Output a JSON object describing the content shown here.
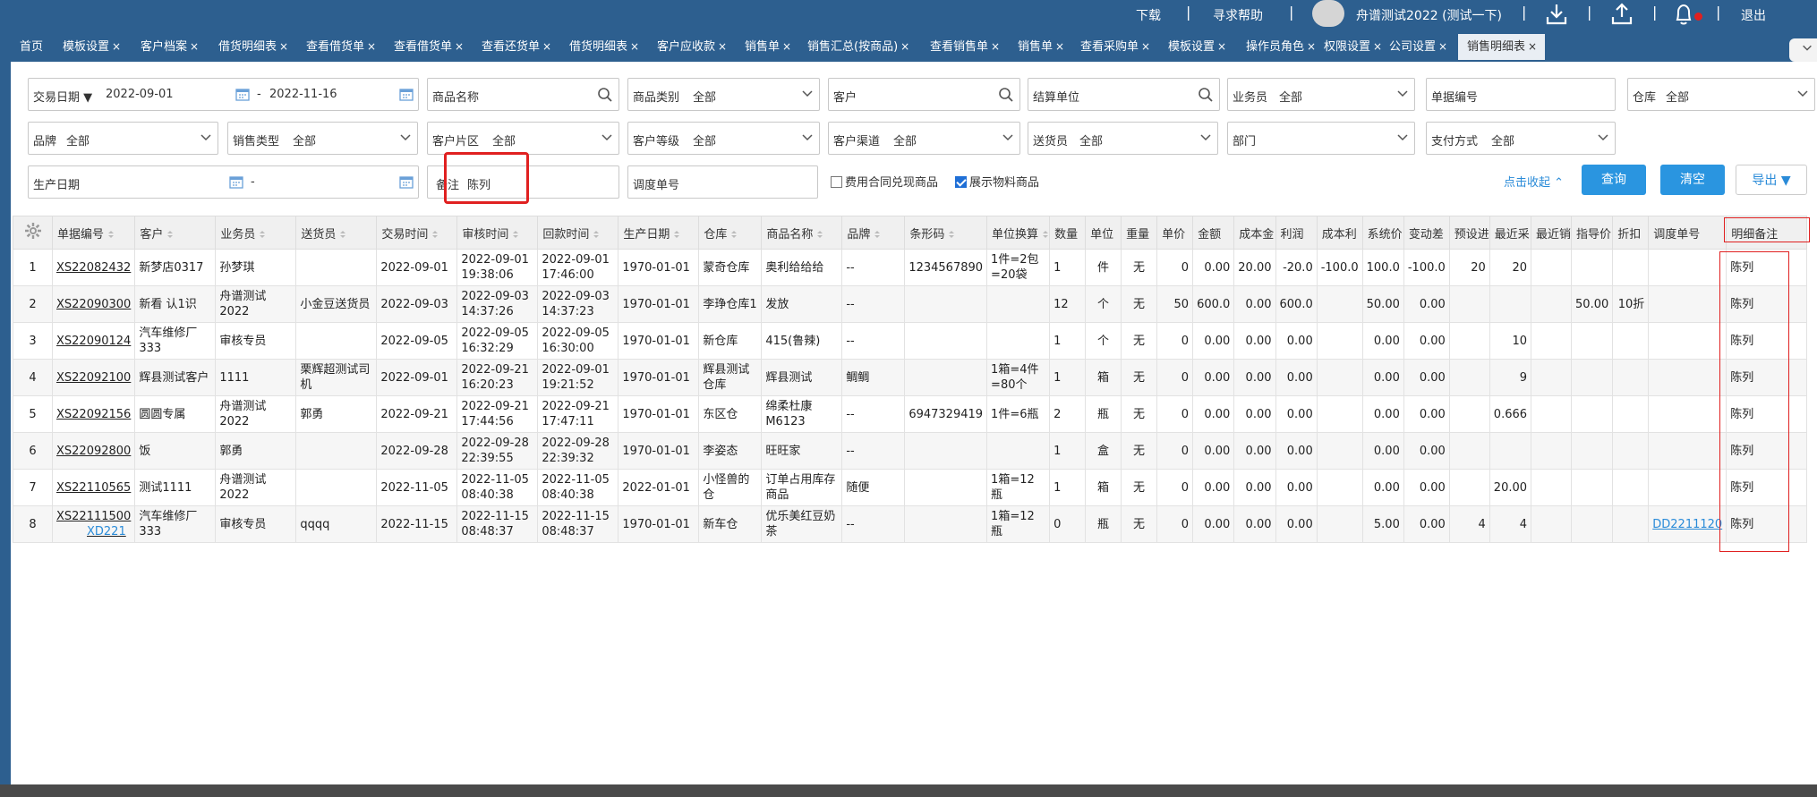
{
  "header": {
    "download": "下载",
    "help": "寻求帮助",
    "user": "舟谱测试2022 (测试一下)",
    "logout": "退出",
    "sep": "|"
  },
  "tabs": [
    {
      "label": "首页",
      "closable": false
    },
    {
      "label": "模板设置",
      "closable": true
    },
    {
      "label": "客户档案",
      "closable": true
    },
    {
      "label": "借货明细表",
      "closable": true
    },
    {
      "label": "查看借货单",
      "closable": true
    },
    {
      "label": "查看借货单",
      "closable": true
    },
    {
      "label": "查看还货单",
      "closable": true
    },
    {
      "label": "借货明细表",
      "closable": true
    },
    {
      "label": "客户应收款",
      "closable": true
    },
    {
      "label": "销售单",
      "closable": true
    },
    {
      "label": "销售汇总(按商品)",
      "closable": true
    },
    {
      "label": "查看销售单",
      "closable": true
    },
    {
      "label": "销售单",
      "closable": true
    },
    {
      "label": "查看采购单",
      "closable": true
    },
    {
      "label": "模板设置",
      "closable": true
    },
    {
      "label": "操作员角色",
      "closable": true
    },
    {
      "label": "权限设置",
      "closable": true
    },
    {
      "label": "公司设置",
      "closable": true
    },
    {
      "label": "销售明细表",
      "closable": true,
      "active": true
    }
  ],
  "tab_close": "×",
  "filters": {
    "trade_date_label": "交易日期 ▼",
    "date_from": "2022-09-01",
    "date_sep": "-",
    "date_to": "2022-11-16",
    "product_name_placeholder": "商品名称",
    "product_category_label": "商品类别",
    "customer_placeholder": "客户",
    "settle_unit_placeholder": "结算单位",
    "salesman_label": "业务员",
    "doc_no_placeholder": "单据编号",
    "warehouse_label": "仓库",
    "brand_label": "品牌",
    "sales_type_label": "销售类型",
    "customer_area_label": "客户片区",
    "customer_level_label": "客户等级",
    "customer_channel_label": "客户渠道",
    "deliverer_label": "送货员",
    "department_placeholder": "部门",
    "payment_label": "支付方式",
    "production_date_label": "生产日期",
    "production_sep": "-",
    "remark_label": "备注",
    "remark_value": "陈列",
    "dispatch_placeholder": "调度单号",
    "all": "全部"
  },
  "checks": {
    "fee_contract": "费用合同兑现商品",
    "fee_contract_checked": false,
    "show_material": "展示物料商品",
    "show_material_checked": true
  },
  "actions": {
    "collapse": "点击收起 ⌃",
    "query": "查询",
    "clear": "清空",
    "export": "导出 ▼"
  },
  "table": {
    "columns": [
      "单据编号",
      "客户",
      "业务员",
      "送货员",
      "交易时间",
      "审核时间",
      "回款时间",
      "生产日期",
      "仓库",
      "商品名称",
      "品牌",
      "条形码",
      "单位换算",
      "数量",
      "单位",
      "重量",
      "单价",
      "金额",
      "成本金",
      "利润",
      "成本利",
      "系统价",
      "变动差",
      "预设进",
      "最近采",
      "最近销",
      "指导价",
      "折扣",
      "调度单号",
      "明细备注"
    ],
    "rows": [
      [
        "1",
        "XS22082432",
        "",
        "新梦店0317",
        "孙梦琪",
        "",
        "2022-09-01",
        "2022-09-01 19:38:06",
        "2022-09-01 17:46:00",
        "1970-01-01",
        "蒙奇仓库",
        "奥利给给给",
        "--",
        "1234567890",
        "1件=2包=20袋",
        "1",
        "件",
        "无",
        "0",
        "0.00",
        "20.00",
        "-20.0",
        "-100.0",
        "100.0",
        "-100.0",
        "20",
        "20",
        "",
        "",
        "",
        "",
        "陈列"
      ],
      [
        "2",
        "XS22090300",
        "",
        "新看 认1识",
        "舟谱测试2022",
        "小金豆送货员",
        "2022-09-03",
        "2022-09-03 14:37:26",
        "2022-09-03 14:37:23",
        "1970-01-01",
        "李琤仓库1",
        "发放",
        "--",
        "",
        "",
        "12",
        "个",
        "无",
        "50",
        "600.0",
        "0.00",
        "600.0",
        "",
        "50.00",
        "0.00",
        "",
        "",
        "",
        "50.00",
        "10折",
        "",
        "陈列"
      ],
      [
        "3",
        "XS22090124",
        "",
        "汽车维修厂333",
        "审核专员",
        "",
        "2022-09-05",
        "2022-09-05 16:32:29",
        "2022-09-05 16:30:00",
        "1970-01-01",
        "新仓库",
        "415(鲁辣)",
        "--",
        "",
        "",
        "1",
        "个",
        "无",
        "0",
        "0.00",
        "0.00",
        "0.00",
        "",
        "0.00",
        "0.00",
        "",
        "10",
        "",
        "",
        "",
        "",
        "陈列"
      ],
      [
        "4",
        "XS22092100",
        "",
        "辉县测试客户",
        "1111",
        "栗辉超测试司机",
        "2022-09-01",
        "2022-09-21 16:20:23",
        "2022-09-01 19:21:52",
        "1970-01-01",
        "辉县测试仓库",
        "辉县测试",
        "鲷鲷",
        "",
        "1箱=4件=80个",
        "1",
        "箱",
        "无",
        "0",
        "0.00",
        "0.00",
        "0.00",
        "",
        "0.00",
        "0.00",
        "",
        "9",
        "",
        "",
        "",
        "",
        "陈列"
      ],
      [
        "5",
        "XS22092156",
        "",
        "圆圆专属",
        "舟谱测试2022",
        "郭勇",
        "2022-09-21",
        "2022-09-21 17:44:56",
        "2022-09-21 17:47:11",
        "1970-01-01",
        "东区仓",
        "绵柔杜康M6123",
        "--",
        "6947329419",
        "1件=6瓶",
        "2",
        "瓶",
        "无",
        "0",
        "0.00",
        "0.00",
        "0.00",
        "",
        "0.00",
        "0.00",
        "",
        "0.666",
        "",
        "",
        "",
        "",
        "陈列"
      ],
      [
        "6",
        "XS22092800",
        "",
        "饭",
        "郭勇",
        "",
        "2022-09-28",
        "2022-09-28 22:39:55",
        "2022-09-28 22:39:32",
        "1970-01-01",
        "李姿态",
        "旺旺家",
        "--",
        "",
        "",
        "1",
        "盒",
        "无",
        "0",
        "0.00",
        "0.00",
        "0.00",
        "",
        "0.00",
        "0.00",
        "",
        "",
        "",
        "",
        "",
        "",
        "陈列"
      ],
      [
        "7",
        "XS22110565",
        "",
        "测试1111",
        "舟谱测试2022",
        "",
        "2022-11-05",
        "2022-11-05 08:40:38",
        "2022-11-05 08:40:38",
        "2022-01-01",
        "小怪兽的仓",
        "订单占用库存商品",
        "随便",
        "",
        "1箱=12瓶",
        "1",
        "箱",
        "无",
        "0",
        "0.00",
        "0.00",
        "0.00",
        "",
        "0.00",
        "0.00",
        "",
        "20.00",
        "",
        "",
        "",
        "",
        "陈列"
      ],
      [
        "8",
        "XS22111500",
        "XD221",
        "汽车维修厂333",
        "审核专员",
        "qqqq",
        "2022-11-15",
        "2022-11-15 08:48:37",
        "2022-11-15 08:48:37",
        "1970-01-01",
        "新车仓",
        "优乐美红豆奶茶",
        "--",
        "",
        "1箱=12瓶",
        "0",
        "瓶",
        "无",
        "0",
        "0.00",
        "0.00",
        "0.00",
        "",
        "5.00",
        "0.00",
        "4",
        "4",
        "",
        "",
        "",
        "DD2211120",
        "陈列"
      ]
    ]
  }
}
